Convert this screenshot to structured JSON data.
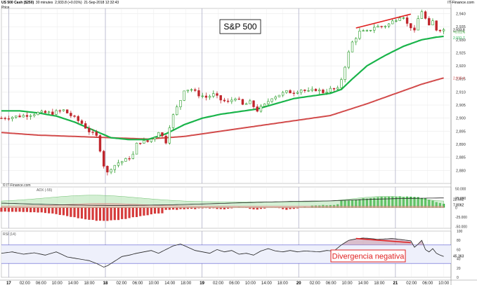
{
  "header": {
    "symbol": "US 500 Cash ($250)",
    "interval": "30 minutes",
    "last": "2,933.8 (+0.01%)",
    "date": "21-Sep-2018 12:32:43",
    "brand": "IT-Finance.com",
    "price_label": "Price"
  },
  "panels": {
    "adx_label": "ADX (-55)",
    "rsi_label": "RSI (14)",
    "copyright": "© IT-Finance.com"
  },
  "annotations": {
    "title_box": "S&P 500",
    "divergence_box": "Divergencia negativa"
  },
  "colors": {
    "candle_up": "#2a9d2a",
    "candle_down": "#c0262c",
    "ma_fast": "#19b44a",
    "ma_slow": "#d24b4b",
    "divergence": "#e02020",
    "rsi_line": "#222222",
    "adx_positive": "#2fae3a",
    "adx_negative": "#d53a3a"
  },
  "chart_data": [
    {
      "type": "candlestick",
      "yticks": [
        2880,
        2885,
        2890,
        2895,
        2900,
        2905,
        2910,
        2915,
        2920,
        2925,
        2930,
        2935,
        2940
      ],
      "ytick_labels": [
        "2,880",
        "2,885",
        "2,890",
        "2,895",
        "2,900",
        "2,905",
        "2,910",
        "2,915",
        "2,920",
        "2,925",
        "2,930",
        "2,935",
        "2,940"
      ],
      "ylim": [
        2875,
        2942
      ],
      "price_tags": [
        {
          "label": "2,933.8",
          "value": 2933.8,
          "color": "#000000"
        },
        {
          "label": "+0.01%",
          "value": 2932.7,
          "color": "#2a9d2a"
        },
        {
          "label": "2,931.7",
          "value": 2931.3,
          "color": "#19b44a"
        },
        {
          "label": "2,915.4",
          "value": 2915.4,
          "color": "#d24b4b"
        }
      ],
      "x_labels": [
        "17",
        "02:00",
        "06:00",
        "10:00",
        "14:00",
        "18:00",
        "18",
        "02:00",
        "06:00",
        "10:00",
        "14:00",
        "18:00",
        "19",
        "02:00",
        "06:00",
        "10:00",
        "14:00",
        "18:00",
        "20",
        "02:00",
        "06:00",
        "10:00",
        "14:00",
        "18:00",
        "21",
        "02:00",
        "06:00",
        "10:00",
        "14:00"
      ],
      "day_labels": [
        "17",
        "18",
        "19",
        "20",
        "21"
      ],
      "close_path": [
        [
          0,
          2900
        ],
        [
          6,
          2901
        ],
        [
          10,
          2902
        ],
        [
          14,
          2902
        ],
        [
          17,
          2903
        ],
        [
          20,
          2900
        ],
        [
          22,
          2898
        ],
        [
          24,
          2895
        ],
        [
          26,
          2893
        ],
        [
          27,
          2888
        ],
        [
          28,
          2882
        ],
        [
          29,
          2879
        ],
        [
          30,
          2881
        ],
        [
          32,
          2883
        ],
        [
          34,
          2884
        ],
        [
          36,
          2886
        ],
        [
          37,
          2890
        ],
        [
          38,
          2891
        ],
        [
          40,
          2891
        ],
        [
          42,
          2893
        ],
        [
          43,
          2895
        ],
        [
          44,
          2893
        ],
        [
          45,
          2891
        ],
        [
          46,
          2897
        ],
        [
          47,
          2901
        ],
        [
          48,
          2904
        ],
        [
          49,
          2907
        ],
        [
          50,
          2911
        ],
        [
          52,
          2911
        ],
        [
          54,
          2909
        ],
        [
          56,
          2908
        ],
        [
          58,
          2909
        ],
        [
          60,
          2907
        ],
        [
          62,
          2906
        ],
        [
          64,
          2908
        ],
        [
          66,
          2905
        ],
        [
          68,
          2906
        ],
        [
          70,
          2903
        ],
        [
          72,
          2905
        ],
        [
          74,
          2908
        ],
        [
          76,
          2909
        ],
        [
          78,
          2910
        ],
        [
          80,
          2910
        ],
        [
          82,
          2911
        ],
        [
          84,
          2910
        ],
        [
          86,
          2911
        ],
        [
          88,
          2910
        ],
        [
          90,
          2911
        ],
        [
          92,
          2911
        ],
        [
          93,
          2915
        ],
        [
          94,
          2920
        ],
        [
          95,
          2925
        ],
        [
          96,
          2929
        ],
        [
          97,
          2931
        ],
        [
          98,
          2933
        ],
        [
          100,
          2933
        ],
        [
          102,
          2935
        ],
        [
          104,
          2935
        ],
        [
          106,
          2936
        ],
        [
          108,
          2938
        ],
        [
          109,
          2939
        ],
        [
          110,
          2939
        ],
        [
          111,
          2936
        ],
        [
          112,
          2935
        ],
        [
          113,
          2933
        ],
        [
          114,
          2938
        ],
        [
          115,
          2941
        ],
        [
          116,
          2938
        ],
        [
          117,
          2935
        ],
        [
          118,
          2937
        ],
        [
          119,
          2934
        ],
        [
          120,
          2934
        ],
        [
          121,
          2933.8
        ]
      ],
      "ma_fast": [
        [
          0,
          2902.8
        ],
        [
          5,
          2902.8
        ],
        [
          10,
          2902
        ],
        [
          15,
          2900.8
        ],
        [
          20,
          2898.5
        ],
        [
          25,
          2895.5
        ],
        [
          30,
          2892.5
        ],
        [
          35,
          2891.8
        ],
        [
          40,
          2891.8
        ],
        [
          45,
          2894
        ],
        [
          50,
          2897.5
        ],
        [
          55,
          2900
        ],
        [
          60,
          2901.5
        ],
        [
          65,
          2902.5
        ],
        [
          70,
          2903.5
        ],
        [
          75,
          2905.5
        ],
        [
          80,
          2907.5
        ],
        [
          85,
          2908.5
        ],
        [
          90,
          2909.5
        ],
        [
          93,
          2911
        ],
        [
          96,
          2915
        ],
        [
          100,
          2920
        ],
        [
          105,
          2924
        ],
        [
          110,
          2927.5
        ],
        [
          115,
          2930
        ],
        [
          119,
          2931
        ],
        [
          121,
          2931.3
        ]
      ],
      "ma_slow": [
        [
          0,
          2894.5
        ],
        [
          10,
          2893.5
        ],
        [
          20,
          2893
        ],
        [
          30,
          2892.5
        ],
        [
          40,
          2892
        ],
        [
          50,
          2893
        ],
        [
          60,
          2895
        ],
        [
          70,
          2897
        ],
        [
          80,
          2899
        ],
        [
          90,
          2901
        ],
        [
          100,
          2905.5
        ],
        [
          110,
          2910.5
        ],
        [
          115,
          2913
        ],
        [
          121,
          2915.4
        ]
      ],
      "divergence_line": [
        [
          97,
          2934.5
        ],
        [
          112,
          2939.8
        ]
      ]
    },
    {
      "type": "histogram",
      "name": "ADX",
      "yticks": [
        50,
        25,
        0,
        -25,
        -50
      ],
      "ytick_labels": [
        "50.000",
        "25.000",
        "0",
        "-25.000",
        "-50.000"
      ],
      "ylim": [
        -55,
        55
      ],
      "value_tags": [
        {
          "label": "22.592",
          "value": 22.6
        },
        {
          "label": "7.8062",
          "value": 7.8
        }
      ]
    },
    {
      "type": "line",
      "name": "RSI",
      "yticks": [
        100,
        80,
        60,
        40,
        20,
        0
      ],
      "ytick_labels": [
        "100",
        "80",
        "60",
        "40",
        "20",
        "0"
      ],
      "ylim": [
        0,
        100
      ],
      "bands": [
        30,
        70
      ],
      "value_tag": "45.363",
      "values": [
        [
          0,
          52
        ],
        [
          3,
          55
        ],
        [
          6,
          50
        ],
        [
          9,
          53
        ],
        [
          12,
          48
        ],
        [
          15,
          55
        ],
        [
          18,
          44
        ],
        [
          21,
          40
        ],
        [
          24,
          36
        ],
        [
          26,
          30
        ],
        [
          28,
          22
        ],
        [
          29,
          25
        ],
        [
          31,
          35
        ],
        [
          33,
          45
        ],
        [
          35,
          48
        ],
        [
          37,
          52
        ],
        [
          39,
          55
        ],
        [
          41,
          58
        ],
        [
          43,
          52
        ],
        [
          45,
          60
        ],
        [
          47,
          68
        ],
        [
          49,
          72
        ],
        [
          51,
          65
        ],
        [
          53,
          58
        ],
        [
          55,
          55
        ],
        [
          57,
          52
        ],
        [
          59,
          60
        ],
        [
          61,
          55
        ],
        [
          63,
          58
        ],
        [
          65,
          50
        ],
        [
          67,
          52
        ],
        [
          69,
          48
        ],
        [
          71,
          57
        ],
        [
          73,
          62
        ],
        [
          75,
          57
        ],
        [
          77,
          55
        ],
        [
          79,
          58
        ],
        [
          81,
          55
        ],
        [
          83,
          57
        ],
        [
          85,
          56
        ],
        [
          87,
          55
        ],
        [
          89,
          58
        ],
        [
          91,
          57
        ],
        [
          93,
          70
        ],
        [
          95,
          80
        ],
        [
          97,
          83
        ],
        [
          99,
          85
        ],
        [
          101,
          84
        ],
        [
          103,
          82
        ],
        [
          105,
          83
        ],
        [
          107,
          84
        ],
        [
          109,
          82
        ],
        [
          111,
          80
        ],
        [
          112,
          79
        ],
        [
          113,
          65
        ],
        [
          114,
          72
        ],
        [
          115,
          80
        ],
        [
          116,
          60
        ],
        [
          117,
          55
        ],
        [
          118,
          62
        ],
        [
          119,
          52
        ],
        [
          120,
          48
        ],
        [
          121,
          45
        ]
      ],
      "divergence_line": [
        [
          97,
          84
        ],
        [
          112,
          75
        ]
      ]
    }
  ]
}
